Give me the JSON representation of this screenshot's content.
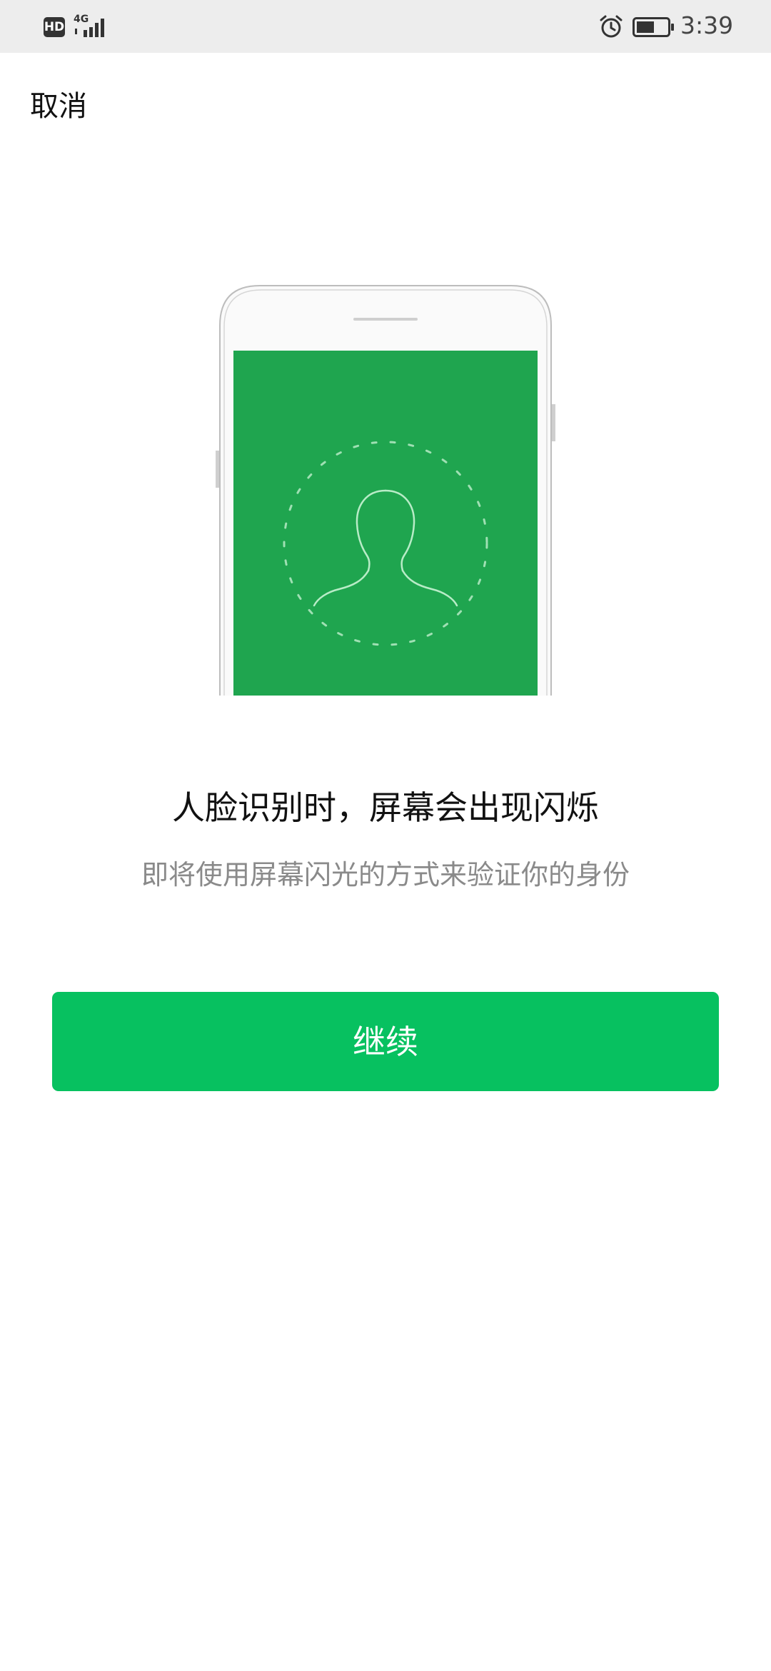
{
  "status_bar": {
    "hd_badge": "HD",
    "network": "4G",
    "time": "3:39",
    "icons": [
      "hd-icon",
      "signal-icon",
      "alarm-icon",
      "battery-icon"
    ]
  },
  "nav": {
    "cancel_label": "取消"
  },
  "illustration": {
    "icon": "face-scan-icon",
    "screen_color": "#1fa54f"
  },
  "content": {
    "headline": "人脸识别时，屏幕会出现闪烁",
    "subline": "即将使用屏幕闪光的方式来验证你的身份"
  },
  "actions": {
    "continue_label": "继续"
  },
  "colors": {
    "accent": "#07c160",
    "status_bar_bg": "#ededed",
    "subtext": "#8a8a8a"
  }
}
